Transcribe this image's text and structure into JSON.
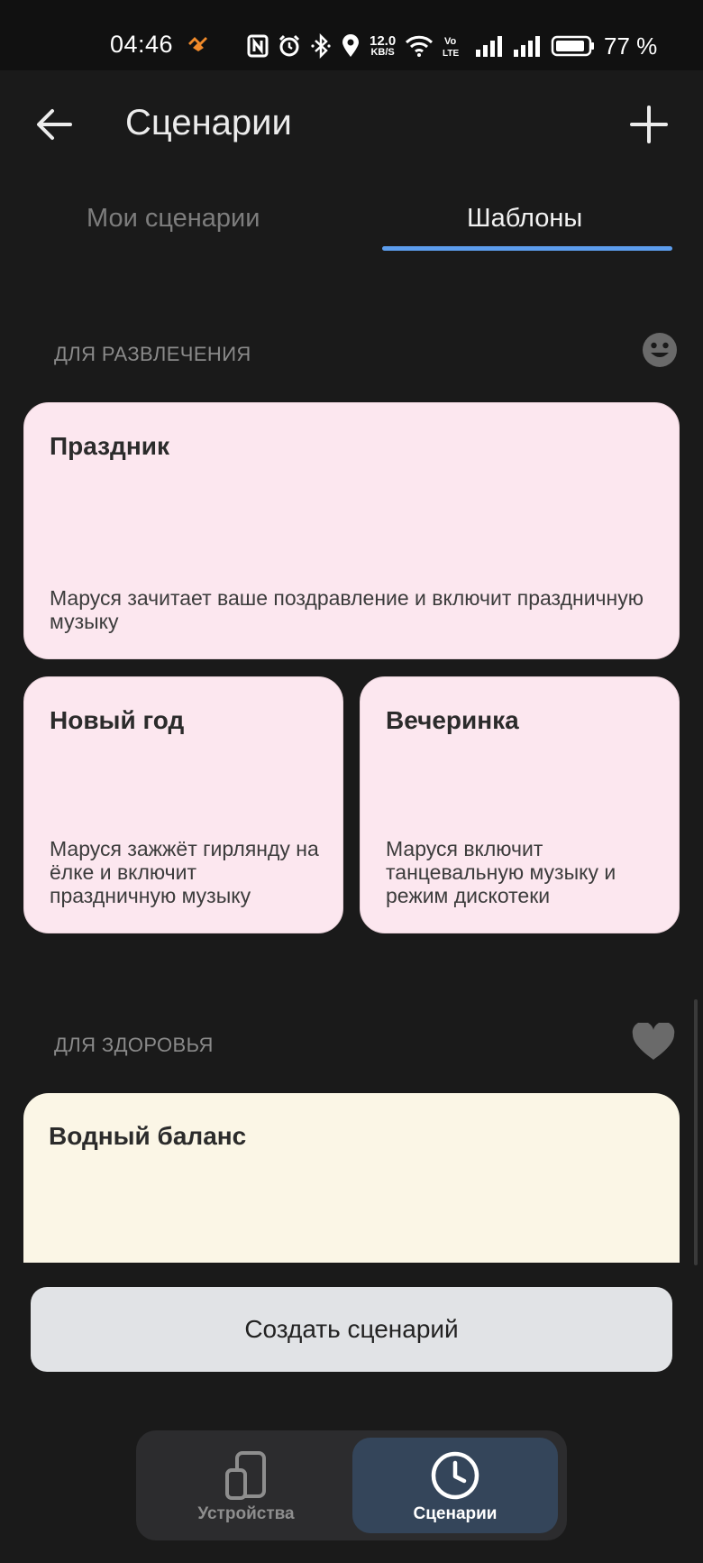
{
  "status_bar": {
    "time": "04:46",
    "speed_value": "12.0",
    "speed_unit": "KB/S",
    "volte": "Vo LTE",
    "battery_percent": "77 %"
  },
  "appbar": {
    "title": "Сценарии"
  },
  "tabs": [
    {
      "label": "Мои сценарии",
      "active": false
    },
    {
      "label": "Шаблоны",
      "active": true
    }
  ],
  "sections": [
    {
      "title": "ДЛЯ РАЗВЛЕЧЕНИЯ",
      "icon": "smiley-icon",
      "cards": [
        {
          "title": "Праздник",
          "description": "Маруся зачитает ваше поздравление и включит праздничную музыку"
        },
        {
          "title": "Новый год",
          "description": "Маруся зажжёт гирлянду на ёлке и включит праздничную музыку"
        },
        {
          "title": "Вечеринка",
          "description": "Маруся включит танцевальную музыку и режим дискотеки"
        }
      ]
    },
    {
      "title": "ДЛЯ ЗДОРОВЬЯ",
      "icon": "heart-icon",
      "cards": [
        {
          "title": "Водный баланс",
          "description": ""
        }
      ]
    }
  ],
  "create_button": {
    "label": "Создать сценарий"
  },
  "bottom_nav": [
    {
      "label": "Устройства",
      "icon": "devices-icon",
      "active": false
    },
    {
      "label": "Сценарии",
      "icon": "clock-icon",
      "active": true
    }
  ],
  "colors": {
    "background": "#1a1a1a",
    "accent": "#5c9ded",
    "card_pink": "#fce7ef",
    "card_cream": "#fbf6e6",
    "nav_active": "#34455a"
  }
}
